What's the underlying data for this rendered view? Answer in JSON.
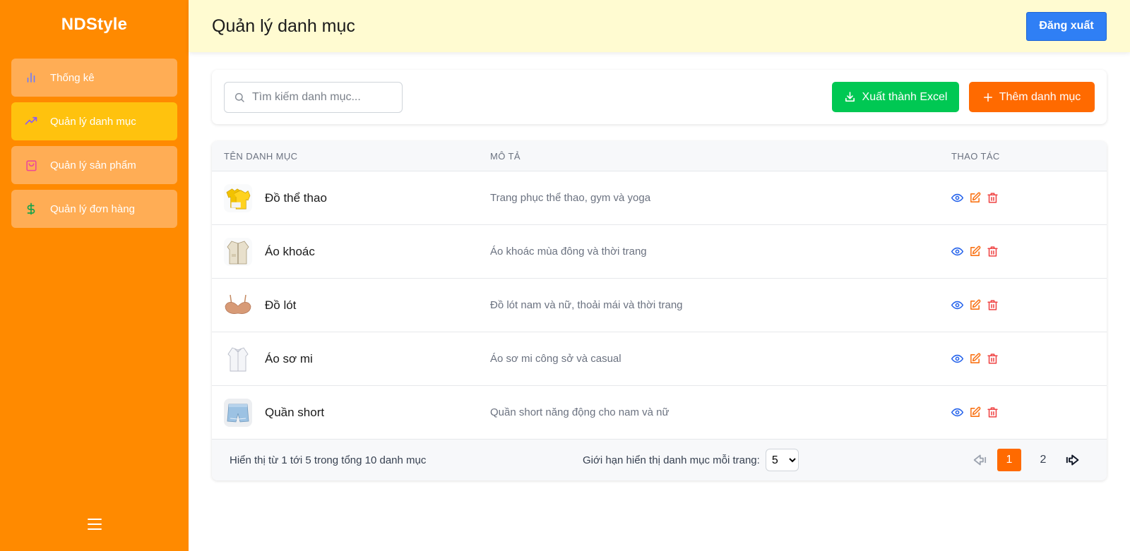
{
  "brand": "NDStyle",
  "sidebar": {
    "items": [
      {
        "label": "Thống kê",
        "icon": "bar-chart-icon"
      },
      {
        "label": "Quản lý danh mục",
        "icon": "trending-up-icon",
        "active": true
      },
      {
        "label": "Quản lý sản phẩm",
        "icon": "shopping-bag-icon"
      },
      {
        "label": "Quản lý đơn hàng",
        "icon": "dollar-icon"
      }
    ]
  },
  "header": {
    "title": "Quản lý danh mục",
    "logout_label": "Đăng xuất"
  },
  "toolbar": {
    "search_placeholder": "Tìm kiếm danh mục...",
    "export_label": "Xuất thành Excel",
    "add_label": "Thêm danh mục"
  },
  "table": {
    "headers": [
      "TÊN DANH MỤC",
      "MÔ TẢ",
      "THAO TÁC"
    ],
    "rows": [
      {
        "name": "Đồ thể thao",
        "description": "Trang phục thể thao, gym và yoga",
        "thumb": "sport-shirt"
      },
      {
        "name": "Áo khoác",
        "description": "Áo khoác mùa đông và thời trang",
        "thumb": "jacket"
      },
      {
        "name": "Đồ lót",
        "description": "Đồ lót nam và nữ, thoải mái và thời trang",
        "thumb": "bra"
      },
      {
        "name": "Áo sơ mi",
        "description": "Áo sơ mi công sở và casual",
        "thumb": "shirt"
      },
      {
        "name": "Quần short",
        "description": "Quần short năng động cho nam và nữ",
        "thumb": "shorts"
      }
    ]
  },
  "footer": {
    "info": "Hiển thị từ 1 tới 5 trong tổng 10 danh mục",
    "limit_label": "Giới hạn hiển thị danh mục mỗi trang:",
    "limit_value": "5",
    "pages": [
      "1",
      "2"
    ],
    "current_page": "1"
  },
  "colors": {
    "sidebar": "#ff8a00",
    "nav_item": "#ffad55",
    "nav_active": "#ffc20e",
    "header_bg": "#fffbd1",
    "logout": "#2f7ff5",
    "excel": "#00c853",
    "add": "#ff6a00",
    "view_icon": "#2563eb",
    "edit_icon": "#f97316",
    "delete_icon": "#ef4444"
  }
}
